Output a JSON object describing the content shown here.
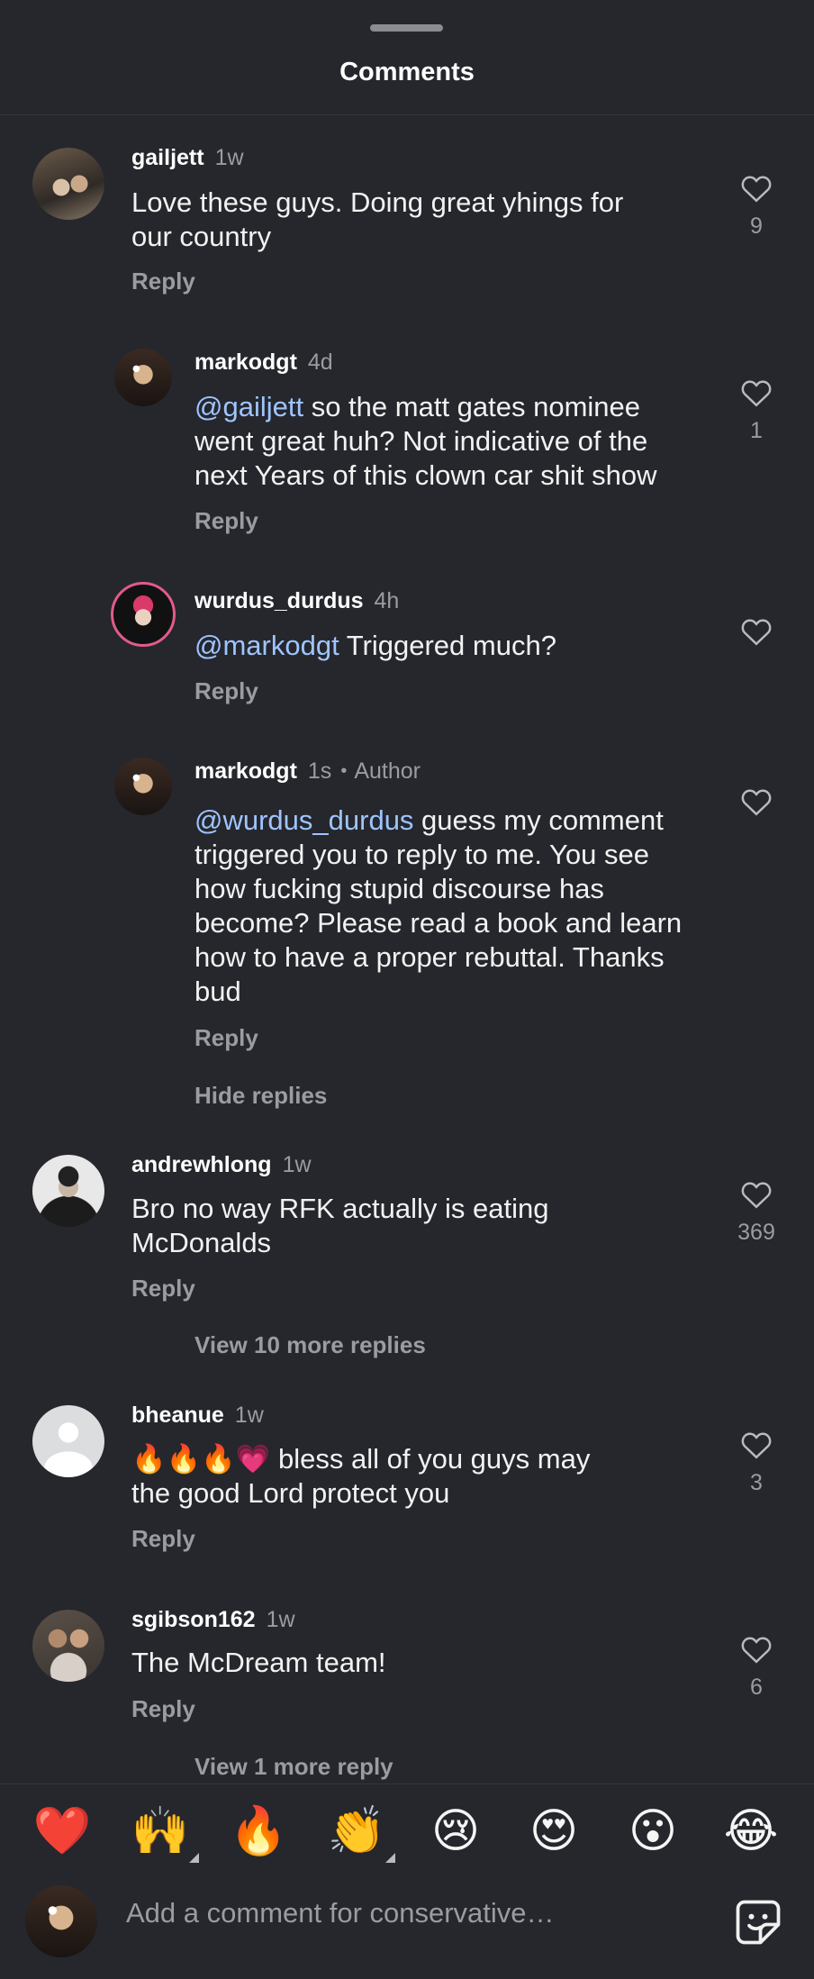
{
  "header": {
    "title": "Comments"
  },
  "comments": [
    {
      "user": "gailjett",
      "time": "1w",
      "mention": "",
      "text": "Love these guys. Doing great yhings for our country",
      "reply": "Reply",
      "likes": "9"
    },
    {
      "user": "markodgt",
      "time": "4d",
      "mention": "@gailjett",
      "text": " so the matt gates nominee went great huh? Not indicative of the next Years of this clown car shit show",
      "reply": "Reply",
      "likes": "1"
    },
    {
      "user": "wurdus_durdus",
      "time": "4h",
      "mention": "@markodgt",
      "text": " Triggered much?",
      "reply": "Reply",
      "likes": ""
    },
    {
      "user": "markodgt",
      "time": "1s",
      "author_badge": "Author",
      "mention": "@wurdus_durdus",
      "text": " guess my comment triggered you to reply to me. You see how fucking stupid discourse has become? Please read a book and learn how to have a proper rebuttal. Thanks bud",
      "reply": "Reply",
      "likes": ""
    },
    {
      "user": "andrewhlong",
      "time": "1w",
      "mention": "",
      "text": "Bro no way RFK actually is eating McDonalds",
      "reply": "Reply",
      "likes": "369"
    },
    {
      "user": "bheanue",
      "time": "1w",
      "mention": "",
      "text": "🔥🔥🔥💗 bless all of you guys may the good Lord protect you",
      "reply": "Reply",
      "likes": "3"
    },
    {
      "user": "sgibson162",
      "time": "1w",
      "mention": "",
      "text": "The McDream team!",
      "reply": "Reply",
      "likes": "6"
    }
  ],
  "thread_links": {
    "hide_replies": "Hide replies",
    "view_10_more": "View 10 more replies",
    "view_1_more": "View 1 more reply"
  },
  "reactions": [
    "❤️",
    "🙌",
    "🔥",
    "👏",
    "😢",
    "😍",
    "😮",
    "😂"
  ],
  "composer": {
    "placeholder": "Add a comment for conservative…"
  },
  "icons": {
    "like": "heart-outline-icon",
    "sticker": "sticker-icon"
  },
  "colors": {
    "background": "#25272c",
    "mention": "#9fc4ff",
    "secondary_text": "#9a9ca1"
  }
}
